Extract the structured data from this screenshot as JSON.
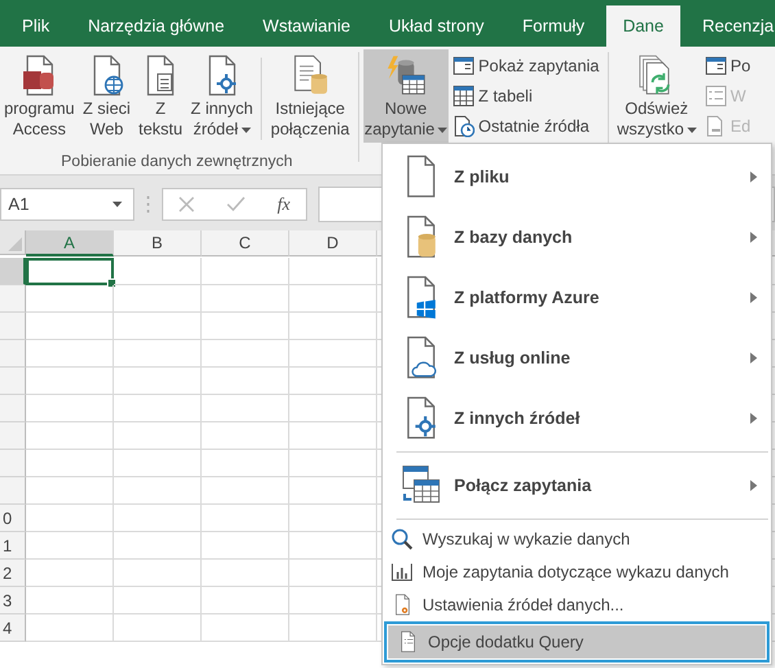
{
  "tabs": [
    {
      "label": "Plik",
      "selected": false
    },
    {
      "label": "Narzędzia główne",
      "selected": false
    },
    {
      "label": "Wstawianie",
      "selected": false
    },
    {
      "label": "Układ strony",
      "selected": false
    },
    {
      "label": "Formuły",
      "selected": false
    },
    {
      "label": "Dane",
      "selected": true
    },
    {
      "label": "Recenzja",
      "selected": false
    }
  ],
  "ribbon": {
    "group_label": "Pobieranie danych zewnętrznych",
    "external_buttons": [
      {
        "lines": [
          "programu",
          "Access"
        ],
        "dropdown": false
      },
      {
        "lines": [
          "Z sieci",
          "Web"
        ],
        "dropdown": false
      },
      {
        "lines": [
          "Z",
          "tekstu"
        ],
        "dropdown": false
      },
      {
        "lines": [
          "Z innych",
          "źródeł"
        ],
        "dropdown": true
      }
    ],
    "connections_button": {
      "lines": [
        "Istniejące",
        "połączenia"
      ]
    },
    "new_query_button": {
      "lines": [
        "Nowe",
        "zapytanie"
      ],
      "dropdown": true,
      "pressed": true
    },
    "query_small_buttons": [
      {
        "label": "Pokaż zapytania",
        "disabled": false
      },
      {
        "label": "Z tabeli",
        "disabled": false
      },
      {
        "label": "Ostatnie źródła",
        "disabled": false
      }
    ],
    "refresh_button": {
      "lines": [
        "Odśwież",
        "wszystko"
      ],
      "dropdown": true
    },
    "connection_small_buttons": [
      {
        "label": "Po",
        "disabled": false
      },
      {
        "label": "W",
        "disabled": true
      },
      {
        "label": "Ed",
        "disabled": true
      }
    ]
  },
  "formula_bar": {
    "name_box": "A1",
    "fx": "fx"
  },
  "sheet": {
    "columns": [
      {
        "label": "A",
        "selected": true
      },
      {
        "label": "B",
        "selected": false
      },
      {
        "label": "C",
        "selected": false
      },
      {
        "label": "D",
        "selected": false
      }
    ],
    "rows": [
      {
        "selected": true
      },
      {
        "selected": false
      },
      {
        "selected": false
      },
      {
        "selected": false
      },
      {
        "selected": false
      },
      {
        "selected": false
      },
      {
        "selected": false
      },
      {
        "selected": false
      },
      {
        "selected": false
      },
      {
        "label": "0",
        "selected": false
      },
      {
        "label": "1",
        "selected": false
      },
      {
        "label": "2",
        "selected": false
      },
      {
        "label": "3",
        "selected": false
      },
      {
        "label": "4",
        "selected": false
      }
    ]
  },
  "menu": {
    "items": [
      {
        "kind": "large",
        "label": "Z pliku",
        "submenu": true,
        "selected": false
      },
      {
        "kind": "large",
        "label": "Z bazy danych",
        "submenu": true,
        "selected": false
      },
      {
        "kind": "large",
        "label": "Z platformy Azure",
        "submenu": true,
        "selected": false
      },
      {
        "kind": "large",
        "label": "Z usług online",
        "submenu": true,
        "selected": false
      },
      {
        "kind": "large",
        "label": "Z innych źródeł",
        "submenu": true,
        "selected": false
      },
      {
        "kind": "separator"
      },
      {
        "kind": "large",
        "label": "Połącz zapytania",
        "submenu": true,
        "selected": false
      },
      {
        "kind": "separator"
      },
      {
        "kind": "small",
        "label": "Wyszukaj w wykazie danych",
        "submenu": false,
        "selected": false
      },
      {
        "kind": "small",
        "label": "Moje zapytania dotyczące wykazu danych",
        "submenu": false,
        "selected": false
      },
      {
        "kind": "small",
        "label": "Ustawienia źródeł danych...",
        "submenu": false,
        "selected": false
      },
      {
        "kind": "small",
        "label": "Opcje dodatku Query",
        "submenu": false,
        "selected": true
      }
    ]
  }
}
